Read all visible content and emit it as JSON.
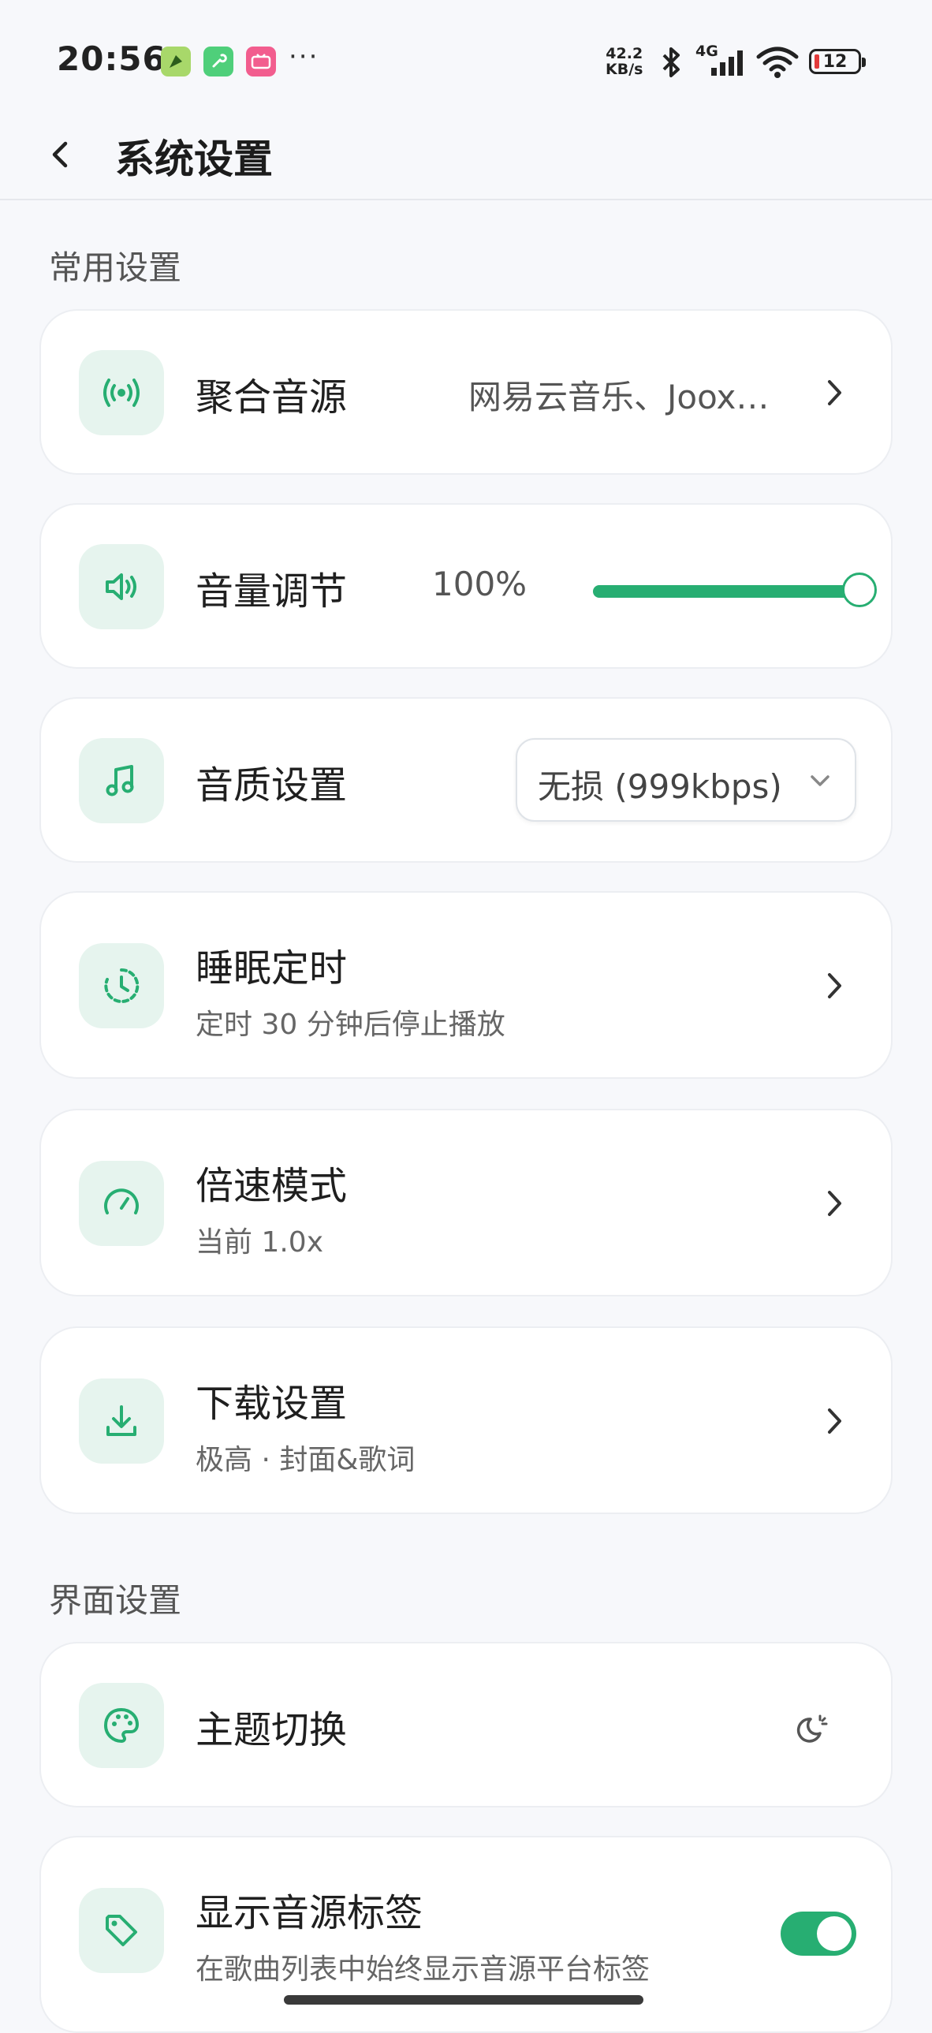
{
  "status_bar": {
    "time": "20:56",
    "speed_value": "42.2",
    "speed_unit": "KB/s",
    "network": "4G",
    "battery": "12",
    "more_dots": "···"
  },
  "header": {
    "title": "系统设置"
  },
  "sections": {
    "common": "常用设置",
    "interface": "界面设置"
  },
  "settings": {
    "source": {
      "label": "聚合音源",
      "value": "网易云音乐、Joox…"
    },
    "volume": {
      "label": "音量调节",
      "value_text": "100%",
      "level": 1.0
    },
    "quality": {
      "label": "音质设置",
      "selected": "无损 (999kbps)"
    },
    "sleep": {
      "label": "睡眠定时",
      "sub": "定时 30 分钟后停止播放"
    },
    "speed": {
      "label": "倍速模式",
      "sub": "当前 1.0x"
    },
    "download": {
      "label": "下载设置",
      "sub": "极高 · 封面&歌词"
    },
    "theme": {
      "label": "主题切换"
    },
    "source_tag": {
      "label": "显示音源标签",
      "sub": "在歌曲列表中始终显示音源平台标签",
      "enabled": true
    }
  },
  "colors": {
    "accent": "#27ae72",
    "icon_bg": "#e6f4ee"
  }
}
